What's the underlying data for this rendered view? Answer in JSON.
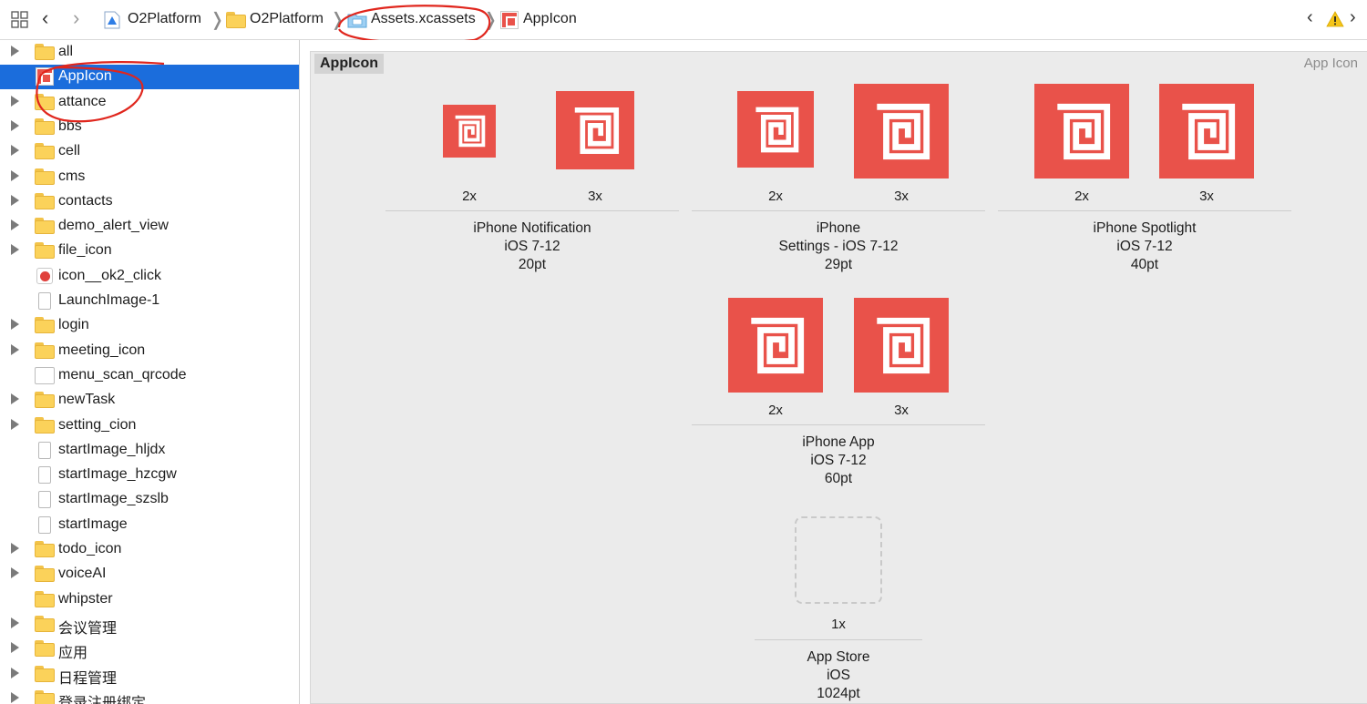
{
  "breadcrumb": {
    "items": [
      "O2Platform",
      "O2Platform",
      "Assets.xcassets",
      "AppIcon"
    ]
  },
  "sidebar": {
    "items": [
      {
        "label": "all",
        "type": "folder",
        "expandable": true
      },
      {
        "label": "AppIcon",
        "type": "appicon",
        "expandable": false,
        "selected": true
      },
      {
        "label": "attance",
        "type": "folder",
        "expandable": true
      },
      {
        "label": "bbs",
        "type": "folder",
        "expandable": true
      },
      {
        "label": "cell",
        "type": "folder",
        "expandable": true
      },
      {
        "label": "cms",
        "type": "folder",
        "expandable": true
      },
      {
        "label": "contacts",
        "type": "folder",
        "expandable": true
      },
      {
        "label": "demo_alert_view",
        "type": "folder",
        "expandable": true
      },
      {
        "label": "file_icon",
        "type": "folder",
        "expandable": true
      },
      {
        "label": "icon__ok2_click",
        "type": "ok",
        "expandable": false
      },
      {
        "label": "LaunchImage-1",
        "type": "file",
        "expandable": false
      },
      {
        "label": "login",
        "type": "folder",
        "expandable": true
      },
      {
        "label": "meeting_icon",
        "type": "folder",
        "expandable": true
      },
      {
        "label": "menu_scan_qrcode",
        "type": "wide",
        "expandable": false
      },
      {
        "label": "newTask",
        "type": "folder",
        "expandable": true
      },
      {
        "label": "setting_cion",
        "type": "folder",
        "expandable": true
      },
      {
        "label": "startImage_hljdx",
        "type": "file",
        "expandable": false
      },
      {
        "label": "startImage_hzcgw",
        "type": "file",
        "expandable": false
      },
      {
        "label": "startImage_szslb",
        "type": "file",
        "expandable": false
      },
      {
        "label": "startImage",
        "type": "file",
        "expandable": false
      },
      {
        "label": "todo_icon",
        "type": "folder",
        "expandable": true
      },
      {
        "label": "voiceAI",
        "type": "folder",
        "expandable": true
      },
      {
        "label": "whipster",
        "type": "folder",
        "expandable": false
      },
      {
        "label": "会议管理",
        "type": "folder",
        "expandable": true
      },
      {
        "label": "应用",
        "type": "folder",
        "expandable": true
      },
      {
        "label": "日程管理",
        "type": "folder",
        "expandable": true
      },
      {
        "label": "登录注册绑定",
        "type": "folder",
        "expandable": true
      }
    ]
  },
  "editor": {
    "set_name": "AppIcon",
    "set_type": "App Icon",
    "groups": [
      {
        "scales": [
          "2x",
          "3x"
        ],
        "lines": [
          "iPhone Notification",
          "iOS 7-12",
          "20pt"
        ]
      },
      {
        "scales": [
          "2x",
          "3x"
        ],
        "lines": [
          "iPhone",
          "Settings - iOS 7-12",
          "29pt"
        ]
      },
      {
        "scales": [
          "2x",
          "3x"
        ],
        "lines": [
          "iPhone Spotlight",
          "iOS 7-12",
          "40pt"
        ]
      },
      {
        "scales": [
          "2x",
          "3x"
        ],
        "lines": [
          "iPhone App",
          "iOS 7-12",
          "60pt"
        ]
      },
      {
        "scales": [
          "1x"
        ],
        "lines": [
          "App Store",
          "iOS",
          "1024pt"
        ]
      }
    ]
  },
  "colors": {
    "icon_red": "#e9524a",
    "selection_blue": "#1b6ddc",
    "annotation_red": "#e0261d"
  }
}
